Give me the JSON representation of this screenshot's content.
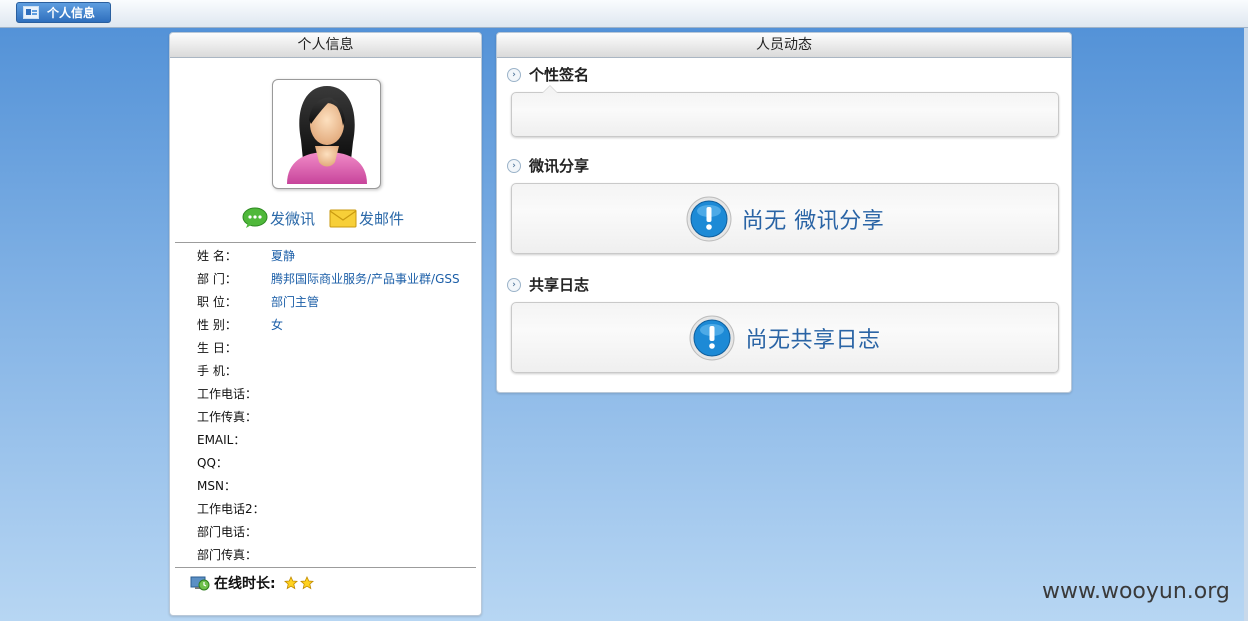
{
  "window": {
    "tab_label": "个人信息"
  },
  "left_panel": {
    "title": "个人信息",
    "actions": {
      "send_message": "发微讯",
      "send_email": "发邮件"
    },
    "profile": [
      {
        "label": "姓 名：",
        "value": "夏静"
      },
      {
        "label": "部 门：",
        "value": "腾邦国际商业服务/产品事业群/GSS"
      },
      {
        "label": "职 位：",
        "value": "部门主管"
      },
      {
        "label": "性 别：",
        "value": "女"
      },
      {
        "label": "生 日：",
        "value": ""
      },
      {
        "label": "手 机：",
        "value": ""
      },
      {
        "label": "工作电话：",
        "value": ""
      },
      {
        "label": "工作传真：",
        "value": ""
      },
      {
        "label": "EMAIL：",
        "value": ""
      },
      {
        "label": "QQ：",
        "value": ""
      },
      {
        "label": "MSN：",
        "value": ""
      },
      {
        "label": "工作电话2：",
        "value": ""
      },
      {
        "label": "部门电话：",
        "value": ""
      },
      {
        "label": "部门传真：",
        "value": ""
      }
    ],
    "online_label": "在线时长:",
    "online_stars": 2
  },
  "right_panel": {
    "title": "人员动态",
    "signature": {
      "title": "个性签名",
      "text": ""
    },
    "weixun": {
      "title": "微讯分享",
      "empty_text": "尚无 微讯分享"
    },
    "journal": {
      "title": "共享日志",
      "empty_text": "尚无共享日志"
    }
  },
  "watermark": "www.wooyun.org",
  "colors": {
    "accent": "#2f6fbd",
    "link": "#1c5fa8",
    "notice_text": "#2a64a5"
  }
}
